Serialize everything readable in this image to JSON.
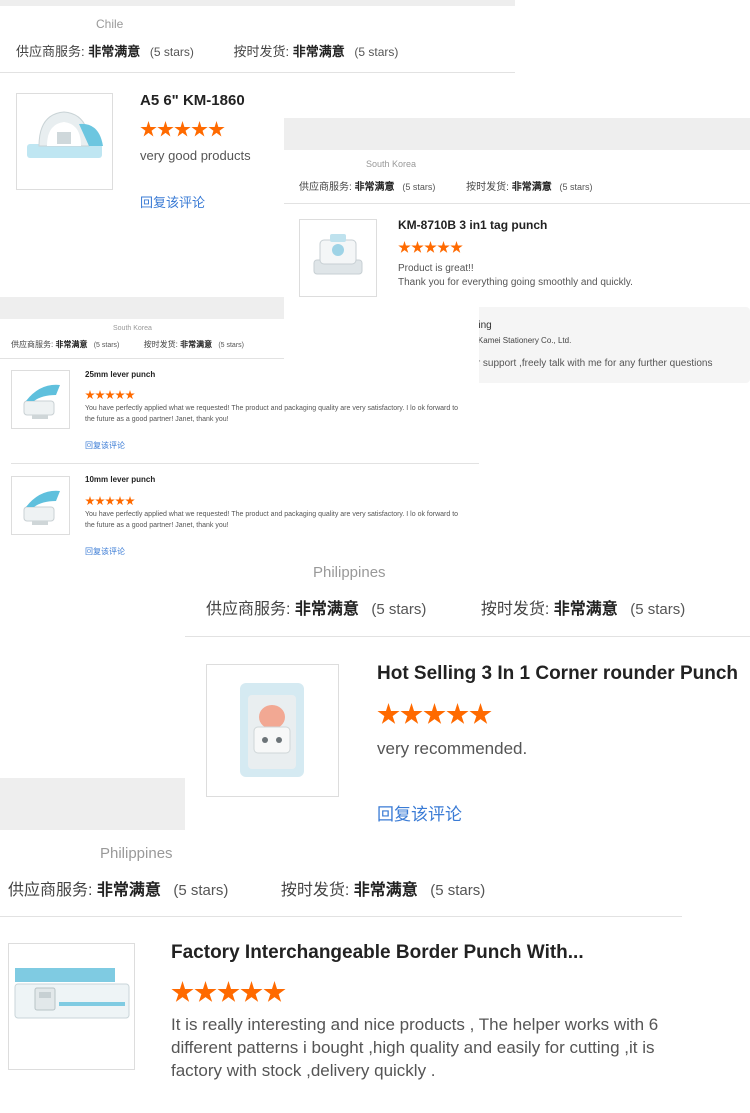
{
  "common": {
    "service_label": "供应商服务:",
    "shipping_label": "按时发货:",
    "rating_value": "非常满意",
    "rating_stars": "(5 stars)",
    "reply_link": "回复该评论"
  },
  "reviews": [
    {
      "country": "Chile",
      "product": "A5 6\" KM-1860",
      "stars": 5,
      "text": "very good products"
    },
    {
      "country": "South Korea",
      "product": "KM-8710B 3 in1 tag punch",
      "stars": 5,
      "text": "Product is great!!\nThank you for everything going smoothly and quickly.",
      "supplier_reply": {
        "name": "Janet Ying",
        "company": "Zhejiang Kamei Stationery Co., Ltd.",
        "message": "thanks for your support ,freely talk with me for any further questions"
      }
    },
    {
      "country": "South Korea",
      "items": [
        {
          "product": "25mm lever punch",
          "stars": 5,
          "text": "You have perfectly applied what we requested! The product and packaging quality are very satisfactory. I lo ok forward to the future as a good partner! Janet, thank you!"
        },
        {
          "product": "10mm lever punch",
          "stars": 5,
          "text": "You have perfectly applied what we requested! The product and packaging quality are very satisfactory. I lo ok forward to the future as a good partner! Janet, thank you!"
        }
      ]
    },
    {
      "country": "Philippines",
      "product": "Hot Selling 3 In 1 Corner rounder Punch",
      "stars": 5,
      "text": "very recommended."
    },
    {
      "country": "Philippines",
      "product": "Factory Interchangeable Border Punch With...",
      "stars": 5,
      "text": "It is really interesting and nice products , The helper works with 6 different patterns i bought ,high quality and easily for cutting ,it is factory with stock ,delivery quickly ."
    }
  ]
}
